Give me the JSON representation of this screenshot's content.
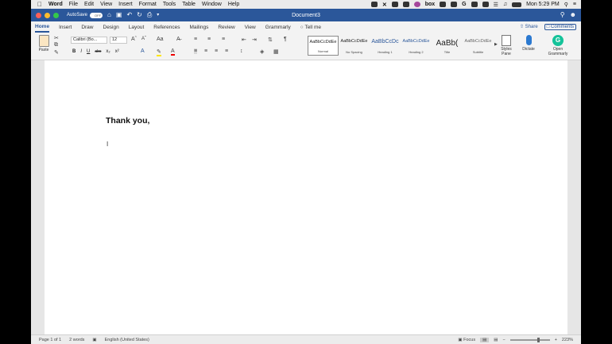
{
  "menubar": {
    "app_name": "Word",
    "items": [
      "File",
      "Edit",
      "View",
      "Insert",
      "Format",
      "Tools",
      "Table",
      "Window",
      "Help"
    ],
    "status_icons": [
      "box"
    ],
    "clock": "Mon 5:29 PM"
  },
  "titlebar": {
    "autosave_label": "AutoSave",
    "autosave_state": "OFF",
    "document_title": "Document3"
  },
  "ribbon_tabs": [
    "Home",
    "Insert",
    "Draw",
    "Design",
    "Layout",
    "References",
    "Mailings",
    "Review",
    "View",
    "Grammarly"
  ],
  "tell_me": "Tell me",
  "share_label": "Share",
  "comments_label": "Comments",
  "ribbon": {
    "paste_label": "Paste",
    "font_name": "Calibri (Bo...",
    "font_size": "12",
    "format_buttons": [
      "B",
      "I",
      "U",
      "abc",
      "x₂",
      "x²"
    ],
    "styles": [
      {
        "preview": "AaBbCcDdEe",
        "name": "Normal"
      },
      {
        "preview": "AaBbCcDdEe",
        "name": "No Spacing"
      },
      {
        "preview": "AaBbCcDc",
        "name": "Heading 1"
      },
      {
        "preview": "AaBbCcDdEe",
        "name": "Heading 2"
      },
      {
        "preview": "AaBb(",
        "name": "Title"
      },
      {
        "preview": "AaBbCcDdEe",
        "name": "Subtitle"
      }
    ],
    "styles_pane_label": "Styles Pane",
    "dictate_label": "Dictate",
    "grammarly_label": "Open Grammarly"
  },
  "document": {
    "body_text": "Thank you,"
  },
  "statusbar": {
    "page": "Page 1 of 1",
    "words": "2 words",
    "language": "English (United States)",
    "focus": "Focus",
    "zoom": "223%"
  }
}
